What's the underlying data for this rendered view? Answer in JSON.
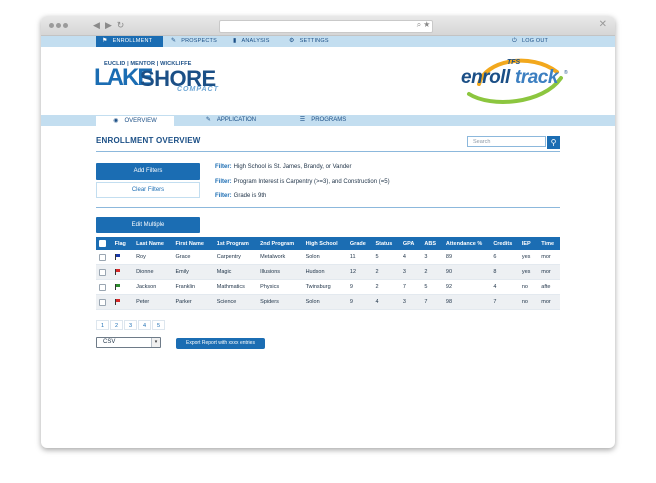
{
  "top_nav": {
    "items": [
      {
        "label": "ENROLLMENT",
        "icon": "flag-icon",
        "active": true
      },
      {
        "label": "PROSPECTS",
        "icon": "pin-icon",
        "active": false
      },
      {
        "label": "ANALYSIS",
        "icon": "bar-chart-icon",
        "active": false
      },
      {
        "label": "SETTINGS",
        "icon": "gear-icon",
        "active": false
      }
    ],
    "logout": {
      "label": "LOG OUT",
      "icon": "power-icon"
    }
  },
  "logo_lakeshore": {
    "towns": "EUCLID | MENTOR | WICKLIFFE",
    "lake": "LAKE",
    "shore": "SHORE",
    "compact": "COMPACT"
  },
  "logo_enrolltrack": {
    "tfs": "TFS",
    "enroll": "enroll",
    "track": "track",
    "mark": "®"
  },
  "sub_nav": {
    "tabs": [
      {
        "label": "OVERVIEW",
        "icon": "eye-icon",
        "active": true
      },
      {
        "label": "APPLICATION",
        "icon": "pencil-icon",
        "active": false
      },
      {
        "label": "PROGRAMS",
        "icon": "list-icon",
        "active": false
      }
    ]
  },
  "page_title": "ENROLLMENT OVERVIEW",
  "search": {
    "placeholder": "Search"
  },
  "add_filters_label": "Add Filters",
  "clear_filters_label": "Clear Filters",
  "filters": [
    {
      "label": "Filter:",
      "text": "High School is St. James, Brandy, or Vander"
    },
    {
      "label": "Filter:",
      "text": "Program Interest is Carpentry (>=3), and Construction (=5)"
    },
    {
      "label": "Filter:",
      "text": "Grade is 9th"
    }
  ],
  "edit_multiple_label": "Edit Multiple",
  "table": {
    "columns": [
      "",
      "Flag",
      "Last Name",
      "First Name",
      "1st Program",
      "2nd Program",
      "High School",
      "Grade",
      "Status",
      "GPA",
      "ABS",
      "Attendance %",
      "Credits",
      "IEP",
      "Time"
    ],
    "rows": [
      {
        "flag_color": "#1b3aa8",
        "cells": [
          "Roy",
          "Grace",
          "Carpentry",
          "Metalwork",
          "Solon",
          "11",
          "5",
          "4",
          "3",
          "89",
          "6",
          "yes",
          "mor"
        ]
      },
      {
        "flag_color": "#d62828",
        "cells": [
          "Dionne",
          "Emily",
          "Magic",
          "Illusions",
          "Hudson",
          "12",
          "2",
          "3",
          "2",
          "90",
          "8",
          "yes",
          "mor"
        ]
      },
      {
        "flag_color": "#2e8b2e",
        "cells": [
          "Jackson",
          "Franklin",
          "Mathmatics",
          "Physics",
          "Twinsburg",
          "9",
          "2",
          "7",
          "5",
          "92",
          "4",
          "no",
          "afte"
        ]
      },
      {
        "flag_color": "#d62828",
        "cells": [
          "Peter",
          "Parker",
          "Science",
          "Spiders",
          "Solon",
          "9",
          "4",
          "3",
          "7",
          "98",
          "7",
          "no",
          "mor"
        ]
      }
    ]
  },
  "pagination": [
    "1",
    "2",
    "3",
    "4",
    "5"
  ],
  "export_format": "CSV",
  "export_label": "Export Report with xxxx entries",
  "colors": {
    "primary": "#1b6db3",
    "nav_bg": "#c3def0",
    "text": "#1d3146"
  }
}
